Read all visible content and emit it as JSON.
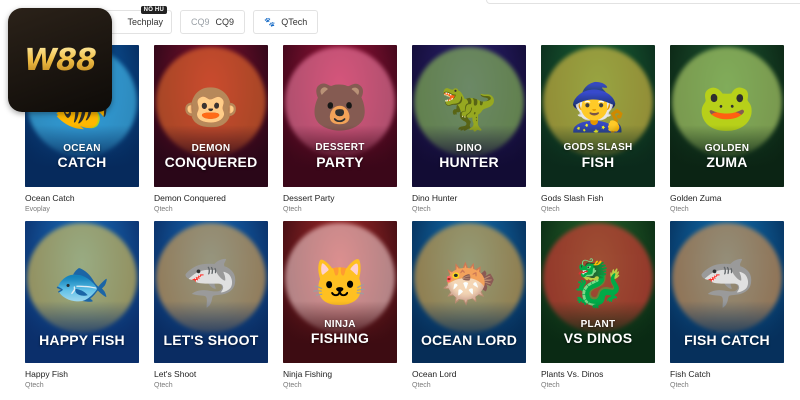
{
  "logo": {
    "text": "W88"
  },
  "providers": [
    {
      "label": "Techplay",
      "badge": "NỔ HŨ",
      "icon": "techplay-icon"
    },
    {
      "label": "CQ9",
      "icon": "cq9-icon"
    },
    {
      "label": "QTech",
      "icon": "paw-icon"
    }
  ],
  "games": [
    {
      "title": "Ocean Catch",
      "provider": "Evoplay",
      "line1": "OCEAN",
      "line2": "CATCH",
      "icon": "fish-icon",
      "bg": "#0e66b3",
      "bg2": "#062a5c",
      "glow": "#4fd0ff"
    },
    {
      "title": "Demon Conquered",
      "provider": "Qtech",
      "line1": "DEMON",
      "line2": "CONQUERED",
      "icon": "monkey-king-icon",
      "bg": "#8a1230",
      "bg2": "#2a0718",
      "glow": "#ff7a2f"
    },
    {
      "title": "Dessert Party",
      "provider": "Qtech",
      "line1": "DESSERT",
      "line2": "PARTY",
      "icon": "bear-chef-icon",
      "bg": "#a5153e",
      "bg2": "#3b0719",
      "glow": "#ff8ab0"
    },
    {
      "title": "Dino Hunter",
      "provider": "Qtech",
      "line1": "DINO",
      "line2": "HUNTER",
      "icon": "dinosaur-icon",
      "bg": "#2f2476",
      "bg2": "#120c34",
      "glow": "#9fdc5a"
    },
    {
      "title": "Gods Slash Fish",
      "provider": "Qtech",
      "line1": "GODS SLASH",
      "line2": "FISH",
      "icon": "god-of-wealth-icon",
      "bg": "#1c6a3a",
      "bg2": "#0b2a1b",
      "glow": "#ffd54a"
    },
    {
      "title": "Golden Zuma",
      "provider": "Qtech",
      "line1": "GOLDEN",
      "line2": "ZUMA",
      "icon": "frog-icon",
      "bg": "#1f5a34",
      "bg2": "#0b2414",
      "glow": "#d2f07a"
    },
    {
      "title": "Happy Fish",
      "provider": "Qtech",
      "line1": "",
      "line2": "HAPPY FISH",
      "icon": "goldfish-icon",
      "bg": "#1c79c9",
      "bg2": "#0b2f6b",
      "glow": "#ffd54a"
    },
    {
      "title": "Let's Shoot",
      "provider": "Qtech",
      "line1": "",
      "line2": "LET'S SHOOT",
      "icon": "shark-cannon-icon",
      "bg": "#1773c4",
      "bg2": "#0a2c62",
      "glow": "#ffb347"
    },
    {
      "title": "Ninja Fishing",
      "provider": "Qtech",
      "line1": "NINJA",
      "line2": "FISHING",
      "icon": "cat-ninja-icon",
      "bg": "#b22d2d",
      "bg2": "#3d0c12",
      "glow": "#ffe0e0"
    },
    {
      "title": "Ocean Lord",
      "provider": "Qtech",
      "line1": "",
      "line2": "OCEAN LORD",
      "icon": "ocean-lord-icon",
      "bg": "#147cc0",
      "bg2": "#062d57",
      "glow": "#ffb43a"
    },
    {
      "title": "Plants Vs. Dinos",
      "provider": "Qtech",
      "line1": "PLANT",
      "line2": "VS DINOS",
      "icon": "dragon-icon",
      "bg": "#2a6b2e",
      "bg2": "#0a2a14",
      "glow": "#ff3a3a"
    },
    {
      "title": "Fish Catch",
      "provider": "Qtech",
      "line1": "",
      "line2": "FISH CATCH",
      "icon": "shark-icon",
      "bg": "#127bbd",
      "bg2": "#06305c",
      "glow": "#ff9f43"
    }
  ]
}
